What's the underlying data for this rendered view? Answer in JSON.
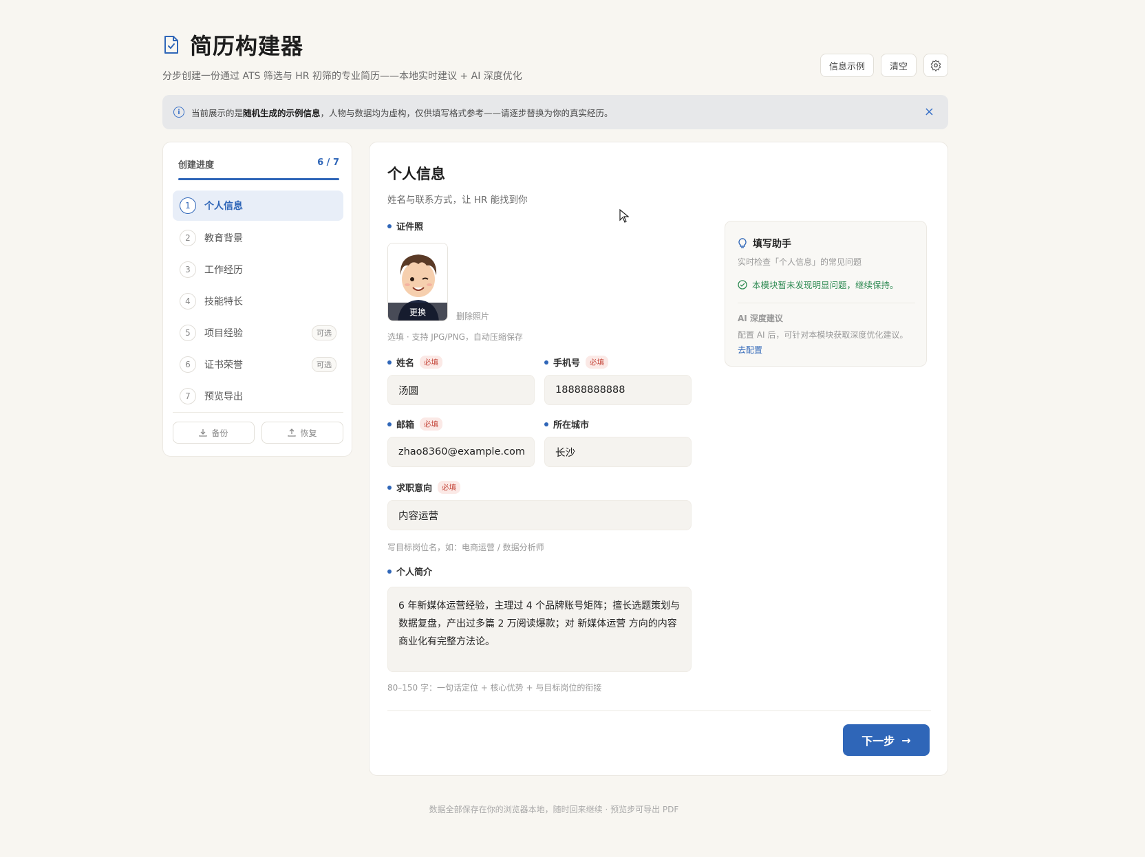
{
  "app": {
    "title": "简历构建器",
    "subtitle": "分步创建一份通过 ATS 筛选与 HR 初筛的专业简历——本地实时建议 + AI 深度优化",
    "actions": {
      "example_label": "信息示例",
      "clear_label": "清空",
      "settings_icon": "gear-icon"
    }
  },
  "notice": {
    "prefix": "当前展示的是",
    "emph": "随机生成的示例信息",
    "suffix": "，人物与数据均为虚构，仅供填写格式参考——请逐步替换为你的真实经历。",
    "close_icon": "close-icon"
  },
  "sidebar": {
    "progress_label": "创建进度",
    "progress_count": "6 / 7",
    "progress_fraction": 1.0,
    "steps": [
      {
        "num": "1",
        "label": "个人信息",
        "active": true
      },
      {
        "num": "2",
        "label": "教育背景"
      },
      {
        "num": "3",
        "label": "工作经历"
      },
      {
        "num": "4",
        "label": "技能特长"
      },
      {
        "num": "5",
        "label": "项目经验",
        "optional": "可选"
      },
      {
        "num": "6",
        "label": "证书荣誉",
        "optional": "可选"
      },
      {
        "num": "7",
        "label": "预览导出"
      }
    ],
    "backup_label": "备份",
    "restore_label": "恢复"
  },
  "form": {
    "title": "个人信息",
    "subtitle": "姓名与联系方式，让 HR 能找到你",
    "photo": {
      "label": "证件照",
      "change_label": "更换",
      "delete_label": "删除照片",
      "hint": "选填 · 支持 JPG/PNG，自动压缩保存"
    },
    "required_tag": "必填",
    "name": {
      "label": "姓名",
      "value": "汤圆"
    },
    "phone": {
      "label": "手机号",
      "value": "18888888888"
    },
    "email": {
      "label": "邮箱",
      "value": "zhao8360@example.com"
    },
    "city": {
      "label": "所在城市",
      "value": "长沙"
    },
    "intent": {
      "label": "求职意向",
      "value": "内容运营",
      "hint": "写目标岗位名，如：电商运营 / 数据分析师"
    },
    "bio": {
      "label": "个人简介",
      "value": "6 年新媒体运营经验，主理过 4 个品牌账号矩阵；擅长选题策划与数据复盘，产出过多篇 2 万阅读爆款；对 新媒体运营 方向的内容商业化有完整方法论。",
      "hint": "80–150 字：一句话定位 + 核心优势 + 与目标岗位的衔接"
    },
    "next_label": "下一步"
  },
  "helper": {
    "title": "填写助手",
    "subtitle": "实时检查「个人信息」的常见问题",
    "ok_text": "本模块暂未发现明显问题，继续保持。",
    "ai_title": "AI 深度建议",
    "ai_text": "配置 AI 后，可针对本模块获取深度优化建议。",
    "ai_link": "去配置"
  },
  "footer": "数据全部保存在你的浏览器本地，随时回来继续 · 预览步可导出 PDF",
  "colors": {
    "accent": "#2f66b8",
    "success": "#2e8a52",
    "required": "#c64a3e",
    "background": "#f8f6f1"
  }
}
